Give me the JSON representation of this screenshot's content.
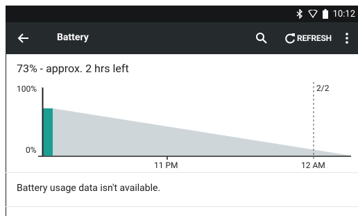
{
  "status_bar": {
    "time": "10:12",
    "icons": [
      "bluetooth-icon",
      "wifi-icon",
      "battery-icon"
    ]
  },
  "app_bar": {
    "title": "Battery",
    "refresh_label": "REFRESH",
    "icons": [
      "back-arrow-icon",
      "search-icon",
      "refresh-icon",
      "overflow-menu-icon"
    ]
  },
  "battery": {
    "summary": "73% - approx. 2 hrs left",
    "level_percent": 73
  },
  "chart": {
    "y_max_label": "100%",
    "y_min_label": "0%",
    "x_labels": [
      "11 PM",
      "12 AM"
    ],
    "page_indicator": "2/2"
  },
  "chart_data": {
    "type": "area",
    "title": "",
    "xlabel": "",
    "ylabel": "",
    "ylim": [
      0,
      100
    ],
    "x_tick_labels": [
      "11 PM",
      "12 AM"
    ],
    "series": [
      {
        "values": [
          73,
          0
        ]
      }
    ],
    "colors": {
      "charged_segment": "#1c9e92",
      "projection_fill": "#cfd6da"
    }
  },
  "usage": {
    "message": "Battery usage data isn't available."
  }
}
